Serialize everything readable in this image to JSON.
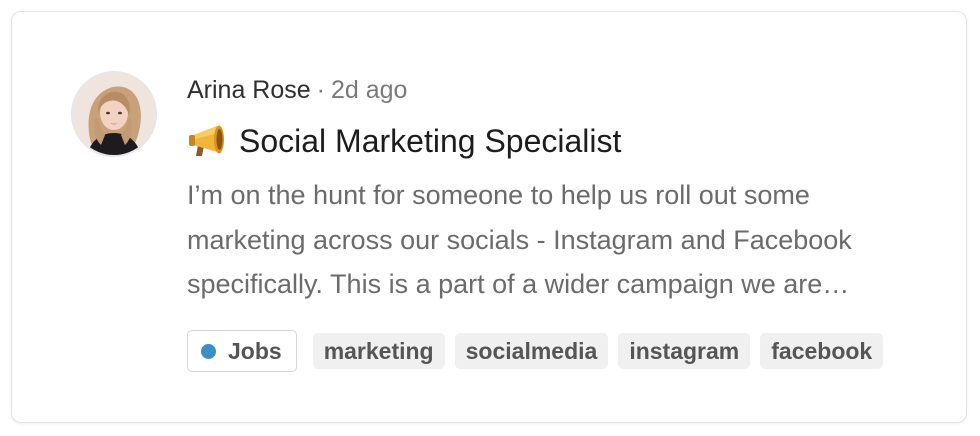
{
  "post": {
    "author": "Arina Rose",
    "separator": "·",
    "time_ago": "2d ago",
    "title_icon": "megaphone-icon",
    "title": "Social Marketing Specialist",
    "excerpt": "I’m on the hunt for someone to help us roll out some marketing across our socials - Instagram and Facebook specifically. This is a part of a wider campaign we are putting together for the launch.",
    "category": {
      "label": "Jobs",
      "color": "#3b8fc7"
    },
    "tags": [
      "marketing",
      "socialmedia",
      "instagram",
      "facebook"
    ]
  }
}
